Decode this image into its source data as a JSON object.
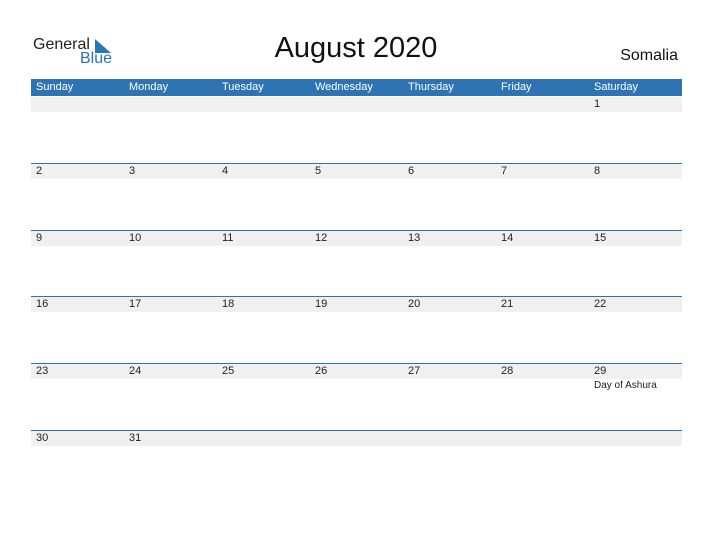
{
  "logo": {
    "general": "General",
    "blue": "Blue"
  },
  "title": "August 2020",
  "country": "Somalia",
  "weekdays": [
    "Sunday",
    "Monday",
    "Tuesday",
    "Wednesday",
    "Thursday",
    "Friday",
    "Saturday"
  ],
  "weeks": [
    {
      "days": [
        "",
        "",
        "",
        "",
        "",
        "",
        "1"
      ],
      "holidays": [
        "",
        "",
        "",
        "",
        "",
        "",
        ""
      ]
    },
    {
      "days": [
        "2",
        "3",
        "4",
        "5",
        "6",
        "7",
        "8"
      ],
      "holidays": [
        "",
        "",
        "",
        "",
        "",
        "",
        ""
      ]
    },
    {
      "days": [
        "9",
        "10",
        "11",
        "12",
        "13",
        "14",
        "15"
      ],
      "holidays": [
        "",
        "",
        "",
        "",
        "",
        "",
        ""
      ]
    },
    {
      "days": [
        "16",
        "17",
        "18",
        "19",
        "20",
        "21",
        "22"
      ],
      "holidays": [
        "",
        "",
        "",
        "",
        "",
        "",
        ""
      ]
    },
    {
      "days": [
        "23",
        "24",
        "25",
        "26",
        "27",
        "28",
        "29"
      ],
      "holidays": [
        "",
        "",
        "",
        "",
        "",
        "",
        "Day of Ashura"
      ]
    },
    {
      "days": [
        "30",
        "31",
        "",
        "",
        "",
        "",
        ""
      ],
      "holidays": [
        "",
        "",
        "",
        "",
        "",
        "",
        ""
      ]
    }
  ]
}
